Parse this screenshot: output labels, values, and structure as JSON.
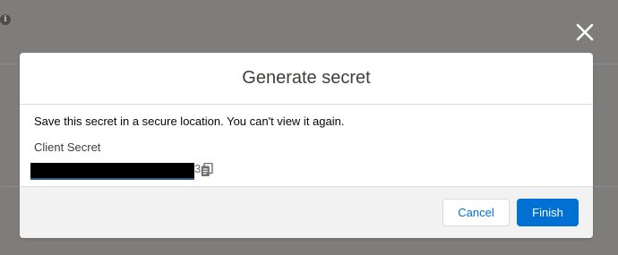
{
  "modal": {
    "title": "Generate secret",
    "message": "Save this secret in a secure location. You can't view it again.",
    "field_label": "Client Secret",
    "secret_visible_tail": "3",
    "cancel_label": "Cancel",
    "finish_label": "Finish"
  },
  "icons": {
    "close": "close-icon",
    "copy": "copy-icon",
    "info": "info-icon"
  },
  "background_glyph": "i",
  "colors": {
    "brand_blue": "#0070d2",
    "backdrop": "#7f7d7c",
    "footer_bg": "#f3f2f2",
    "border": "#dddbda"
  }
}
